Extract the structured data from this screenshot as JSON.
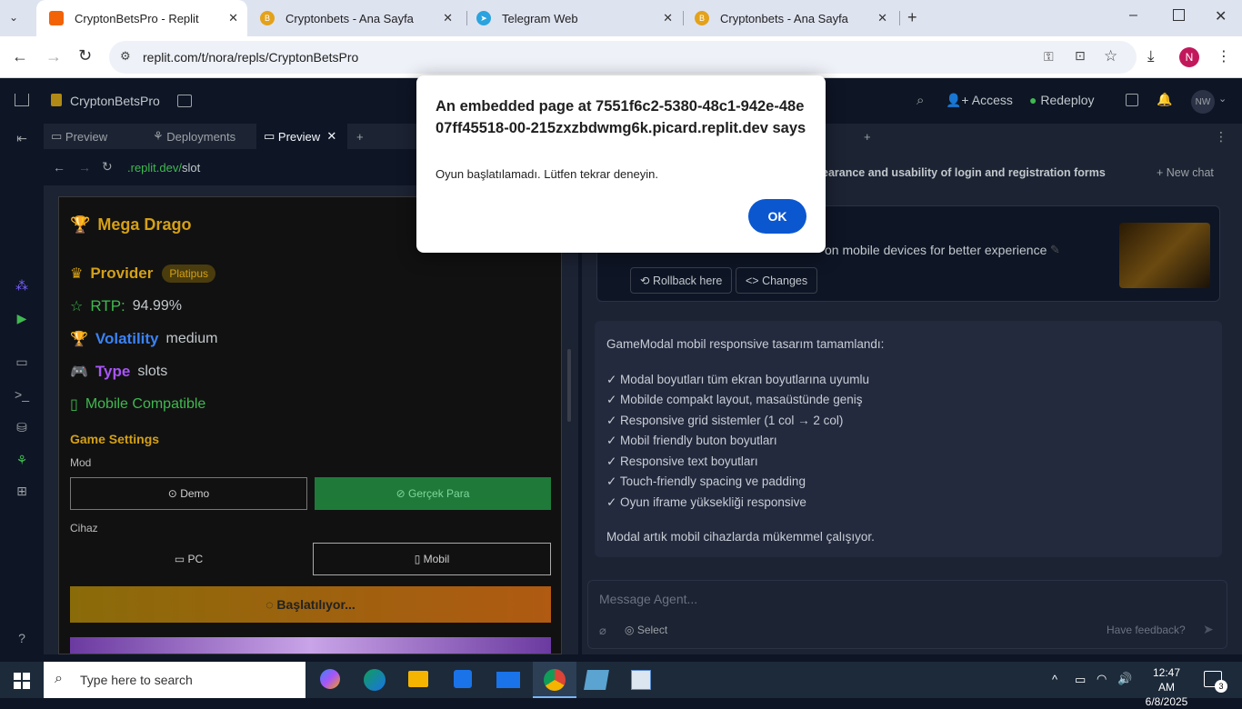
{
  "browser": {
    "tabs": [
      {
        "title": "CryptonBetsPro - Replit"
      },
      {
        "title": "Cryptonbets - Ana Sayfa"
      },
      {
        "title": "Telegram Web"
      },
      {
        "title": "Cryptonbets - Ana Sayfa"
      }
    ],
    "url": "replit.com/t/nora/repls/CryptonBetsPro",
    "profile_initial": "N"
  },
  "replit": {
    "project_name": "CryptonBetsPro",
    "access_label": "Access",
    "redeploy_label": "Redeploy",
    "user_initials": "NW",
    "left_tabs": [
      "Preview",
      "Deployments",
      "Preview"
    ],
    "preview_url_prefix": ".replit.dev/",
    "preview_url_path": "slot"
  },
  "game": {
    "title": "Mega Drago",
    "provider_label": "Provider",
    "provider_value": "Platipus",
    "rtp_label": "RTP:",
    "rtp_value": "94.99%",
    "volatility_label": "Volatility",
    "volatility_value": "medium",
    "type_label": "Type",
    "type_value": "slots",
    "mobile_label": "Mobile Compatible",
    "settings_title": "Game Settings",
    "mode_label": "Mod",
    "demo_label": "Demo",
    "real_label": "Gerçek Para",
    "device_label": "Cihaz",
    "pc_label": "PC",
    "mobile_btn_label": "Mobil",
    "starting_label": "Başlatılıyor..."
  },
  "chat": {
    "title_fragment": "earance and usability of login and registration forms",
    "new_chat_label": "New chat",
    "checkpoint_text": "on mobile devices for better experience",
    "rollback_label": "Rollback here",
    "changes_label": "Changes",
    "message_lines": [
      "GameModal mobil responsive tasarım tamamlandı:",
      "✓ Modal boyutları tüm ekran boyutlarına uyumlu",
      "✓ Mobilde compakt layout, masaüstünde geniş",
      "✓ Responsive grid sistemler (1 col → 2 col)",
      "✓ Mobil friendly buton boyutları",
      "✓ Responsive text boyutları",
      "✓ Touch-friendly spacing ve padding",
      "✓ Oyun iframe yüksekliği responsive",
      "Modal artık mobil cihazlarda mükemmel çalışıyor."
    ],
    "input_placeholder": "Message Agent...",
    "select_label": "Select",
    "feedback_label": "Have feedback?"
  },
  "dialog": {
    "title": "An embedded page at 7551f6c2-5380-48c1-942e-48e07ff45518-00-215zxzbdwmg6k.picard.replit.dev says",
    "message": "Oyun başlatılamadı. Lütfen tekrar deneyin.",
    "ok_label": "OK"
  },
  "taskbar": {
    "search_placeholder": "Type here to search",
    "time": "12:47 AM",
    "date": "6/8/2025",
    "notification_count": "3"
  },
  "colors": {
    "accent_blue": "#0b57d0",
    "gold": "#d4a017",
    "green_btn": "#1f7a3a"
  }
}
